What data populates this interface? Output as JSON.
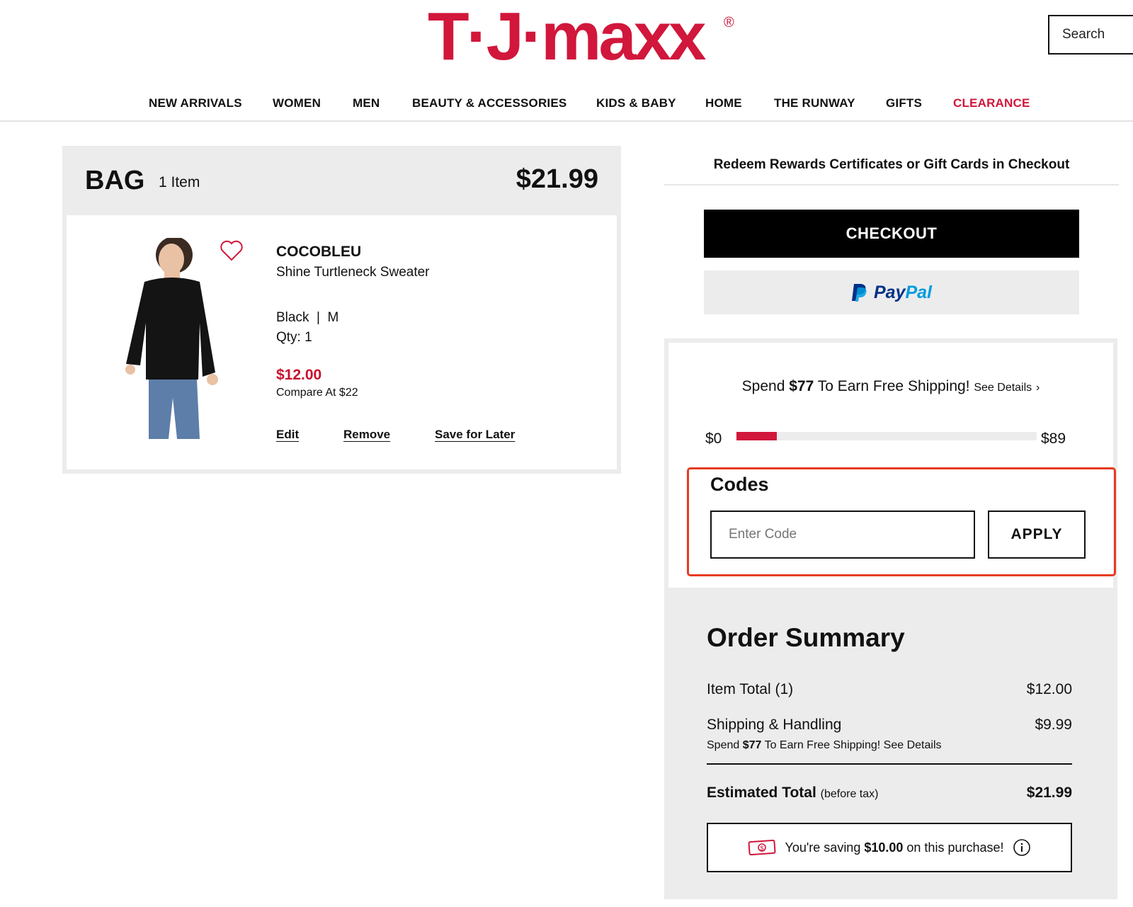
{
  "brand": {
    "logo_text": "T·J·maxx",
    "registered_mark": "®",
    "accent": "#d1173b"
  },
  "header": {
    "search_placeholder": "Search",
    "nav": [
      "NEW ARRIVALS",
      "WOMEN",
      "MEN",
      "BEAUTY & ACCESSORIES",
      "KIDS & BABY",
      "HOME",
      "THE RUNWAY",
      "GIFTS",
      "CLEARANCE"
    ]
  },
  "bag": {
    "title": "BAG",
    "count": "1 Item",
    "total": "$21.99",
    "item": {
      "brand": "COCOBLEU",
      "name": "Shine Turtleneck Sweater",
      "variant": "Black  |  M",
      "qty": "Qty: 1",
      "price": "$12.00",
      "compare": "Compare At $22",
      "actions": {
        "edit": "Edit",
        "remove": "Remove",
        "save": "Save for Later"
      }
    }
  },
  "checkout": {
    "redeem": "Redeem Rewards Certificates or Gift Cards in Checkout",
    "button": "CHECKOUT",
    "paypal_pay": "Pay",
    "paypal_pal": "Pal"
  },
  "shipping": {
    "spend_prefix": "Spend ",
    "amount": "$77",
    "spend_suffix": " To Earn Free Shipping! ",
    "see_details": "See Details",
    "chevron": "›",
    "min_label": "$0",
    "max_label": "$89",
    "progress_fraction": 0.135
  },
  "codes": {
    "title": "Codes",
    "placeholder": "Enter Code",
    "apply": "APPLY",
    "highlight_color": "#e63b1f"
  },
  "summary": {
    "title": "Order Summary",
    "item_total_label": "Item Total (1)",
    "item_total_value": "$12.00",
    "shipping_label": "Shipping & Handling",
    "shipping_value": "$9.99",
    "note_prefix": "Spend ",
    "note_amount": "$77",
    "note_suffix": " To Earn Free Shipping! See Details",
    "est_label": "Estimated Total",
    "est_sub": "(before tax)",
    "est_value": "$21.99",
    "saving_prefix": "You're saving ",
    "saving_amount": "$10.00",
    "saving_suffix": " on this purchase!"
  }
}
